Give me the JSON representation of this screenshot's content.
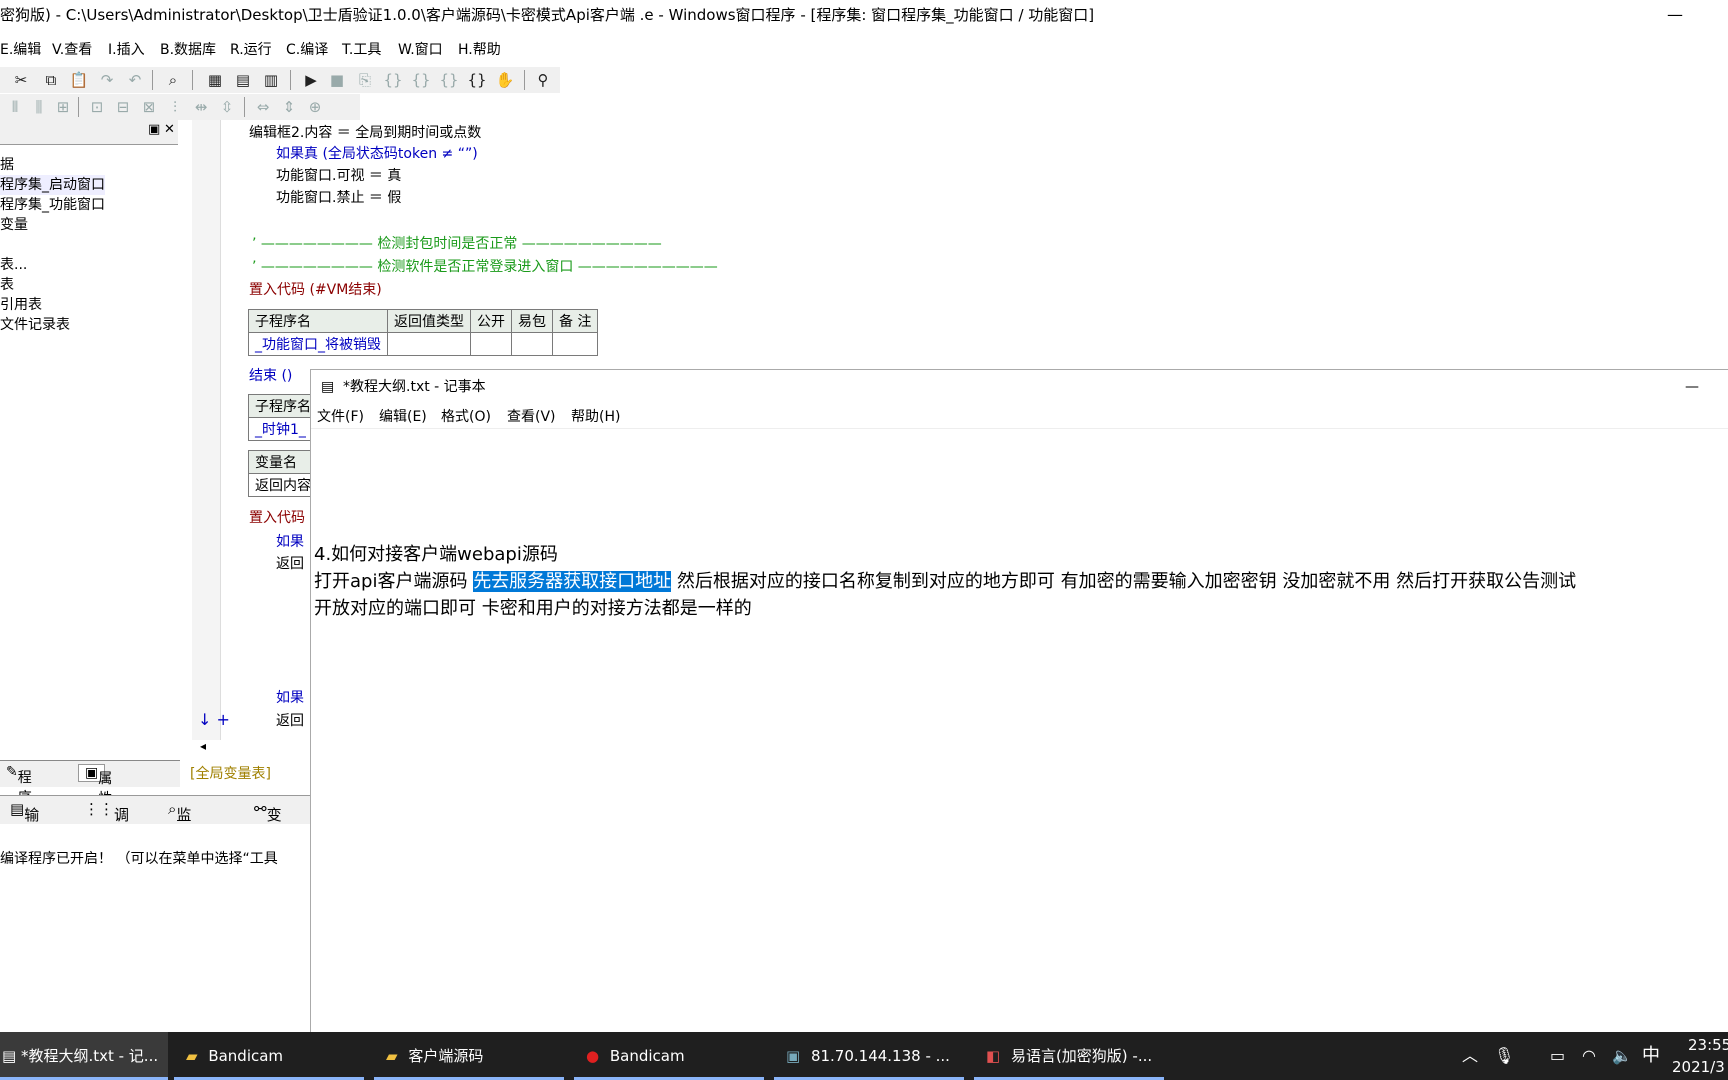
{
  "ide": {
    "title": "密狗版) - C:\\Users\\Administrator\\Desktop\\卫士盾验证1.0.0\\客户端源码\\卡密模式Api客户端 .e - Windows窗口程序 - [程序集: 窗口程序集_功能窗口 / 功能窗口]",
    "minimize": "—",
    "menu": [
      "E.编辑",
      "V.查看",
      "I.插入",
      "B.数据库",
      "R.运行",
      "C.编译",
      "T.工具",
      "W.窗口",
      "H.帮助"
    ],
    "tree": [
      "据",
      "程序集_启动窗口",
      "程序集_功能窗口",
      "变量",
      "",
      "表...",
      "表",
      "引用表",
      "文件记录表"
    ],
    "left_tabs": [
      "程序",
      "属性"
    ],
    "pane_buttons": [
      "▣",
      "✕"
    ],
    "code_lines": [
      "编辑框2.内容 ＝ 全局到期时间或点数",
      "如果真 (全局状态码token ≠ “”)",
      "功能窗口.可视 ＝ 真",
      "功能窗口.禁止 ＝ 假",
      "检测封包时间是否正常",
      "检测软件是否正常登录进入窗口",
      "置入代码 (#VM结束)",
      "结束 ()",
      "置入代码",
      "如果",
      "返回",
      "如果",
      "返回"
    ],
    "table1": {
      "headers": [
        "子程序名",
        "返回值类型",
        "公开",
        "易包",
        "备 注"
      ],
      "row": [
        "_功能窗口_将被销毁",
        "",
        "",
        "",
        ""
      ]
    },
    "table2": {
      "header": "子程序名",
      "row": "_时钟1_"
    },
    "table3": {
      "header": "变量名",
      "row": "返回内容"
    },
    "global_var_tab": "[全局变量表]",
    "out_tabs": [
      "输出",
      "调用表",
      "监视表",
      "变"
    ],
    "output_text": "编译程序已开启！ （可以在菜单中选择“工具"
  },
  "notepad": {
    "title": "*教程大纲.txt - 记事本",
    "minimize": "—",
    "menu": [
      "文件(F)",
      "编辑(E)",
      "格式(O)",
      "查看(V)",
      "帮助(H)"
    ],
    "line1": "4.如何对接客户端webapi源码",
    "line2_a": "打开api客户端源码 ",
    "line2_sel": "先去服务器获取接口地址",
    "line2_b": " 然后根据对应的接口名称复制到对应的地方即可  有加密的需要输入加密密钥 没加密就不用    然后打开获取公告测试",
    "line3": "开放对应的端口即可  卡密和用户的对接方法都是一样的"
  },
  "taskbar": {
    "items": [
      "*教程大纲.txt - 记...",
      "Bandicam",
      "客户端源码",
      "Bandicam",
      "81.70.144.138 - ...",
      "易语言(加密狗版) -..."
    ],
    "tray_ime": "中",
    "time": "23:55",
    "date": "2021/3"
  }
}
